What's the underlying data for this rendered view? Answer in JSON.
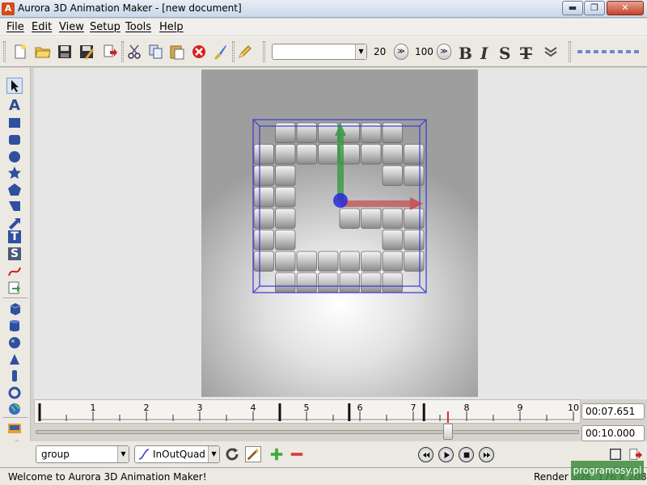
{
  "window": {
    "app_icon_letter": "A",
    "title": "Aurora 3D Animation Maker - [new document]",
    "minimize_glyph": "▬",
    "maximize_glyph": "❐",
    "close_glyph": "✕"
  },
  "menu": [
    {
      "label": "File"
    },
    {
      "label": "Edit"
    },
    {
      "label": "View"
    },
    {
      "label": "Setup"
    },
    {
      "label": "Tools"
    },
    {
      "label": "Help"
    }
  ],
  "toolbar": {
    "icons": [
      "new-file-icon",
      "open-folder-icon",
      "save-icon",
      "save-as-icon",
      "export-icon",
      "cut-icon",
      "copy-icon",
      "paste-icon",
      "delete-icon",
      "clear-icon",
      "edit-pencil-icon"
    ],
    "font_value": "",
    "font_size": "20",
    "percent_value": "100",
    "bold_label": "B",
    "italic_label": "I",
    "shadow_label": "S",
    "strike_label": "T"
  },
  "palette": {
    "text_tool_label": "A",
    "T_label": "T",
    "S_label": "S"
  },
  "timeline": {
    "ticks": [
      "1",
      "2",
      "3",
      "4",
      "5",
      "6",
      "7",
      "8",
      "9",
      "10"
    ],
    "current_time": "00:07.651",
    "total_time": "00:10.000",
    "marker_fraction": 0.765
  },
  "bottom": {
    "object_combo": "group",
    "easing_combo": "InOutQuad"
  },
  "status": {
    "message": "Welcome to Aurora 3D Animation Maker!",
    "render_size": "Render Size: 176 x 208"
  },
  "watermark": "programosy.pl",
  "colors": {
    "accent": "#3a3ad0",
    "axis_y": "#2e9a3c",
    "axis_x": "#c84848"
  }
}
